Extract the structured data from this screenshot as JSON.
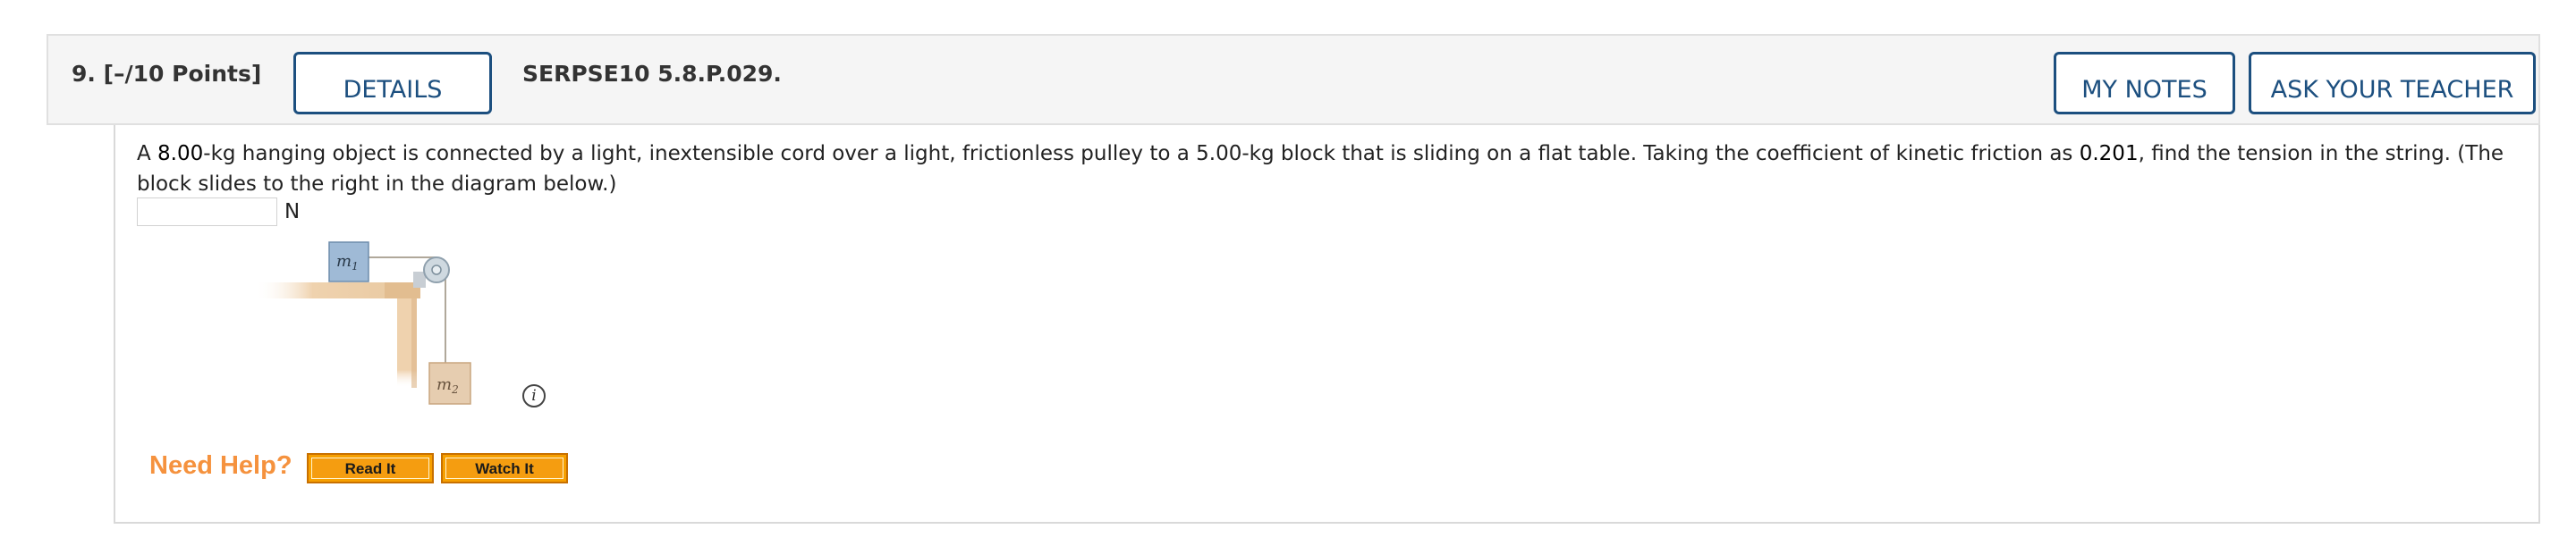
{
  "header": {
    "question_number": "9.  [–/10 Points]",
    "details_label": "DETAILS",
    "problem_code": "SERPSE10 5.8.P.029.",
    "my_notes_label": "MY NOTES",
    "ask_teacher_label": "ASK YOUR TEACHER"
  },
  "problem": {
    "text_1": "A ",
    "mass_hanging": "8.00",
    "text_2": "-kg hanging object is connected by a light, inextensible cord over a light, frictionless pulley to a 5.00-kg block that is sliding on a flat table. Taking the coefficient of kinetic friction as ",
    "mu_k": "0.201",
    "text_3": ", find the tension in the string. (The block slides to the right in the diagram below.)"
  },
  "answer": {
    "value": "",
    "unit": "N"
  },
  "diagram": {
    "m1_label": "m",
    "m1_sub": "1",
    "m2_label": "m",
    "m2_sub": "2",
    "colors": {
      "block1": "#9fbad6",
      "block2": "#e6cdb0",
      "table": "#efd2ae"
    }
  },
  "info_icon": "info-icon",
  "help": {
    "title": "Need Help?",
    "read_it": "Read It",
    "watch_it": "Watch It"
  }
}
